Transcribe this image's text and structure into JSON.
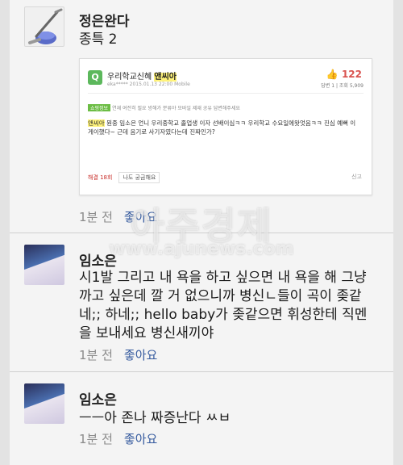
{
  "comments": [
    {
      "author": "정은완다",
      "text": "종특 2",
      "time": "1분 전",
      "like_label": "좋아요",
      "avatar_icon": "vacuum-cleaner-icon",
      "card": {
        "badge": "Q",
        "title_prefix": "우리학교신혜 ",
        "title_highlight": "앤씨아",
        "sub": "eka***** 2015.01.13 22:00 Mobile",
        "score_icon": "thumb-icon",
        "score": "122",
        "stats": "답변 1 | 조회 5,909",
        "tags": [
          "쇼핑정보"
        ],
        "tags_text": "연재 여전히 필요 방해가 분류야  모바일 제재 공유 답변해주세요",
        "text_highlight": "앤씨아",
        "text": " 뭔중 임소은 언니 우리중학교 졸업생 이자 선배이심ㅋㅋ 우리학교 수요일에왓엇음ㅋㅋ 진심 예뻐 이 게이했다~ 근데 음기로 사기자였다는데 진짜인가?",
        "actions_count": "해결 18회",
        "actions_button": "나도 궁금해요",
        "report": "신고"
      }
    },
    {
      "author": "임소은",
      "text": "시1발 그리고 내 욕을 하고 싶으면 내 욕을 해 그냥 까고 싶은데 깔 거 없으니까 병신ㄴ들이 곡이 좆같네;; 하네;; hello baby가 좆같으면 휘성한테 직멘을 보내세요 병신새끼야",
      "time": "1분 전",
      "like_label": "좋아요"
    },
    {
      "author": "임소은",
      "text": "ㅡㅡ아 존나 짜증난다 ㅆㅂ",
      "time": "1분 전",
      "like_label": "좋아요"
    }
  ],
  "watermark": {
    "korean": "아주경제",
    "url": "www.ajunews.com"
  }
}
